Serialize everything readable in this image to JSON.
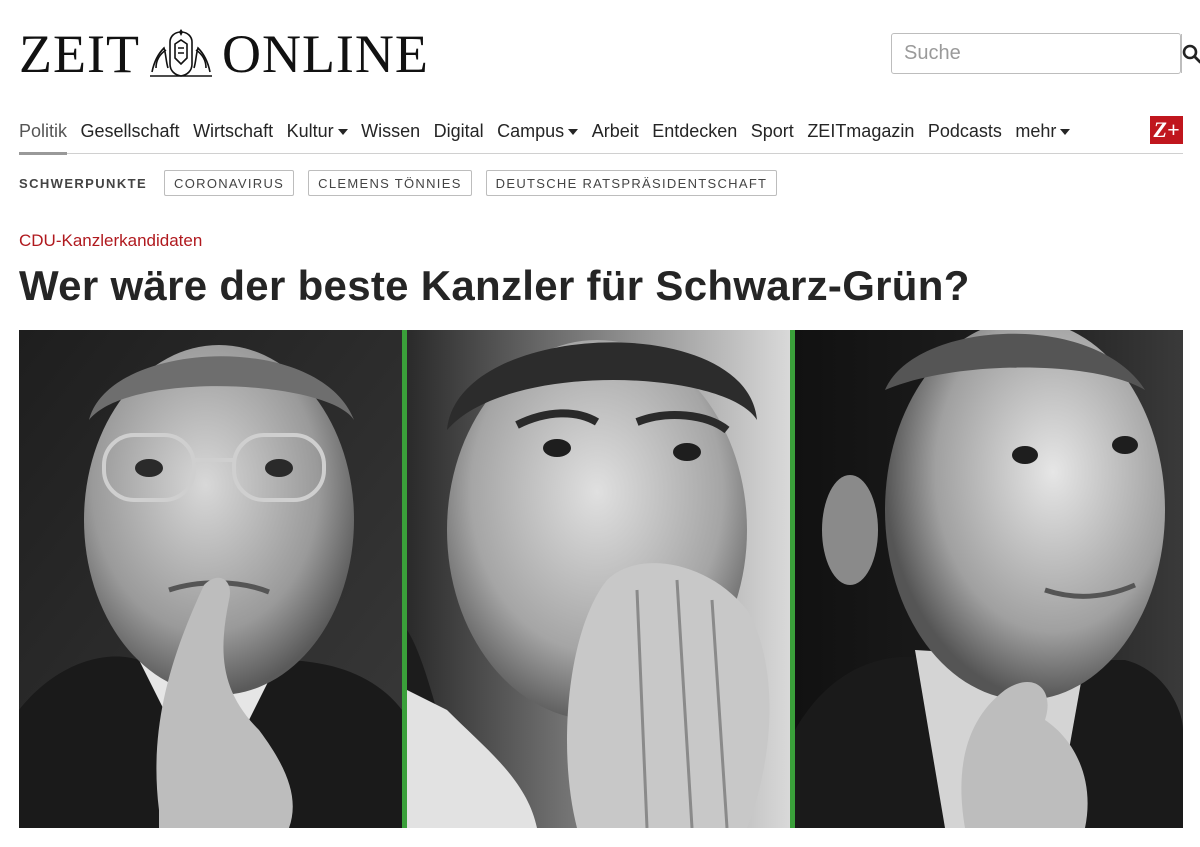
{
  "header": {
    "logo_left": "ZEIT",
    "logo_right": "ONLINE",
    "search_placeholder": "Suche"
  },
  "nav": {
    "items": [
      {
        "label": "Politik",
        "active": true
      },
      {
        "label": "Gesellschaft"
      },
      {
        "label": "Wirtschaft"
      },
      {
        "label": "Kultur",
        "dropdown": true
      },
      {
        "label": "Wissen"
      },
      {
        "label": "Digital"
      },
      {
        "label": "Campus",
        "dropdown": true
      },
      {
        "label": "Arbeit"
      },
      {
        "label": "Entdecken"
      },
      {
        "label": "Sport"
      },
      {
        "label": "ZEITmagazin"
      },
      {
        "label": "Podcasts"
      },
      {
        "label": "mehr",
        "dropdown": true
      }
    ],
    "zplus_label": "Z+"
  },
  "topics": {
    "label": "SCHWERPUNKTE",
    "chips": [
      "CORONAVIRUS",
      "CLEMENS TÖNNIES",
      "DEUTSCHE RATSPRÄSIDENTSCHAFT"
    ]
  },
  "article": {
    "kicker": "CDU-Kanzlerkandidaten",
    "headline": "Wer wäre der beste Kanzler für Schwarz-Grün?"
  },
  "colors": {
    "accent_red": "#b0191e",
    "zplus_red": "#c0161d",
    "separator_green": "#3aa03a"
  },
  "icons": {
    "search": "search-icon",
    "crest": "eagle-crest-icon",
    "dropdown": "chevron-down-icon"
  }
}
